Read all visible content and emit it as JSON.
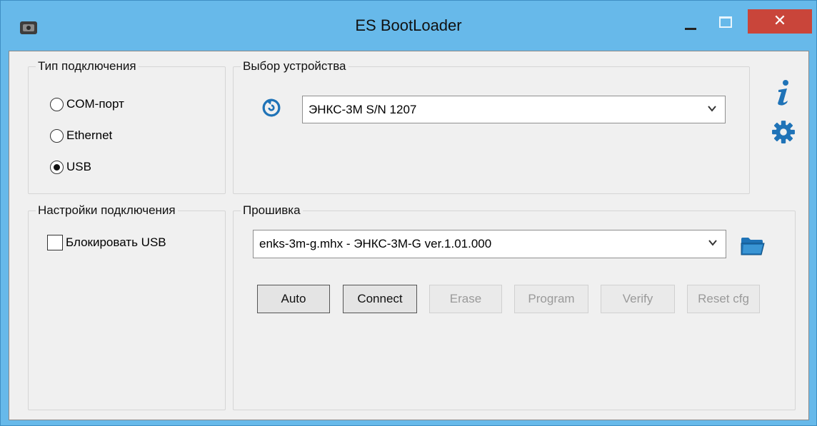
{
  "window": {
    "title": "ES BootLoader",
    "close_symbol": "✕",
    "icons": [
      "app-icon",
      "minimize-icon",
      "maximize-icon",
      "close-icon"
    ]
  },
  "connection_type": {
    "label": "Тип подключения",
    "options": [
      {
        "label": "COM-порт",
        "checked": false
      },
      {
        "label": "Ethernet",
        "checked": false
      },
      {
        "label": "USB",
        "checked": true
      }
    ]
  },
  "device_select": {
    "label": "Выбор устройства",
    "refresh_icon": "refresh-icon",
    "selected": "ЭНКС-3М S/N 1207"
  },
  "connection_settings": {
    "label": "Настройки подключения",
    "block_usb_label": "Блокировать USB",
    "block_usb_checked": false
  },
  "firmware": {
    "label": "Прошивка",
    "selected": "enks-3m-g.mhx  - ЭНКС-3М-G ver.1.01.000",
    "folder_icon": "folder-open-icon"
  },
  "buttons": {
    "auto": "Auto",
    "connect": "Connect",
    "erase": "Erase",
    "program": "Program",
    "verify": "Verify",
    "reset_cfg": "Reset cfg"
  },
  "side_icons": {
    "info": "info-icon",
    "settings": "gear-icon"
  },
  "colors": {
    "title_bar": "#67b9ea",
    "close_button": "#c9453a",
    "client_bg": "#f0f0f0",
    "icon_blue": "#1f73b7"
  }
}
